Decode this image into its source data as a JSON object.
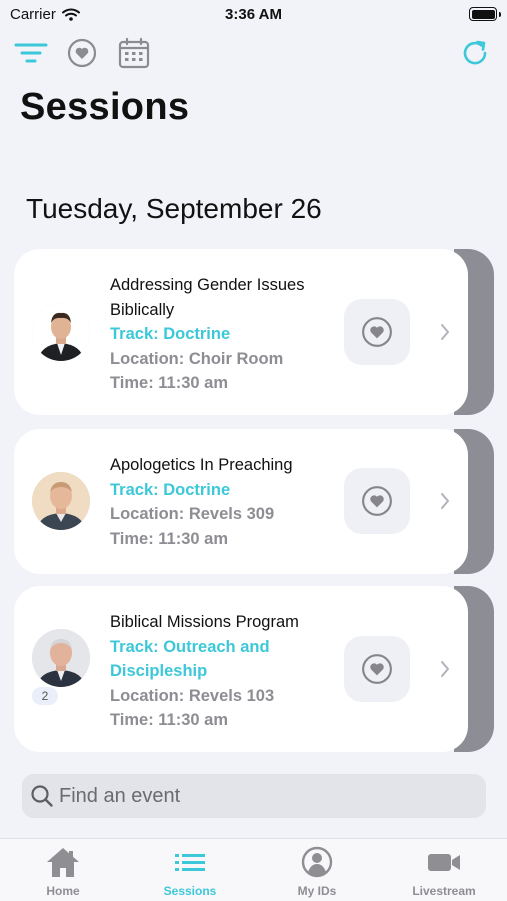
{
  "status_bar": {
    "carrier": "Carrier",
    "time": "3:36 AM"
  },
  "header": {
    "title": "Sessions"
  },
  "date_heading": "Tuesday, September 26",
  "sessions": [
    {
      "title": "Addressing Gender Issues Biblically",
      "track": "Track: Doctrine",
      "location": "Location: Choir Room",
      "time": "Time: 11:30 am"
    },
    {
      "title": "Apologetics In Preaching",
      "track": "Track: Doctrine",
      "location": "Location: Revels 309",
      "time": "Time: 11:30 am"
    },
    {
      "title": "Biblical Missions Program",
      "track": "Track: Outreach and Discipleship",
      "location": "Location: Revels 103",
      "time": "Time: 11:30 am",
      "speaker_count": "2"
    }
  ],
  "search": {
    "placeholder": "Find an event"
  },
  "tabs": [
    {
      "label": "Home",
      "icon": "home-icon"
    },
    {
      "label": "Sessions",
      "icon": "list-icon"
    },
    {
      "label": "My IDs",
      "icon": "person-circle-icon"
    },
    {
      "label": "Livestream",
      "icon": "video-camera-icon"
    }
  ],
  "active_tab": "Sessions",
  "colors": {
    "accent": "#3cc8d8",
    "background": "#f1f3f9",
    "card": "#ffffff",
    "card_edge": "#8d8d95",
    "muted_text": "#8d8d93"
  }
}
